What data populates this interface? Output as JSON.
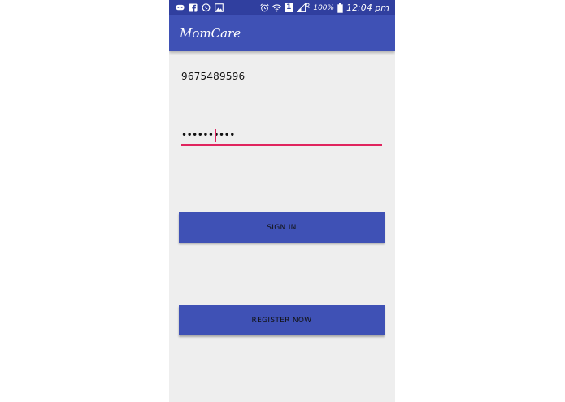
{
  "status_bar": {
    "icons_left": [
      "chat-icon",
      "facebook-icon",
      "whatsapp-icon",
      "gallery-icon"
    ],
    "icons_right": [
      "alarm-icon",
      "wifi-icon",
      "sim-1-icon",
      "signal-icon",
      "battery-icon"
    ],
    "sim_label": "1",
    "roaming_label": "R",
    "battery_percent": "100%",
    "time": "12:04 pm"
  },
  "app_bar": {
    "title": "MomCare"
  },
  "form": {
    "phone_value": "9675489596",
    "password_mask": "••••••••••"
  },
  "buttons": {
    "sign_in_label": "SIGN IN",
    "register_label": "REGISTER NOW"
  },
  "colors": {
    "status_bar": "#303f9f",
    "primary": "#3f51b5",
    "accent": "#e0245e",
    "background": "#eeeeee"
  }
}
